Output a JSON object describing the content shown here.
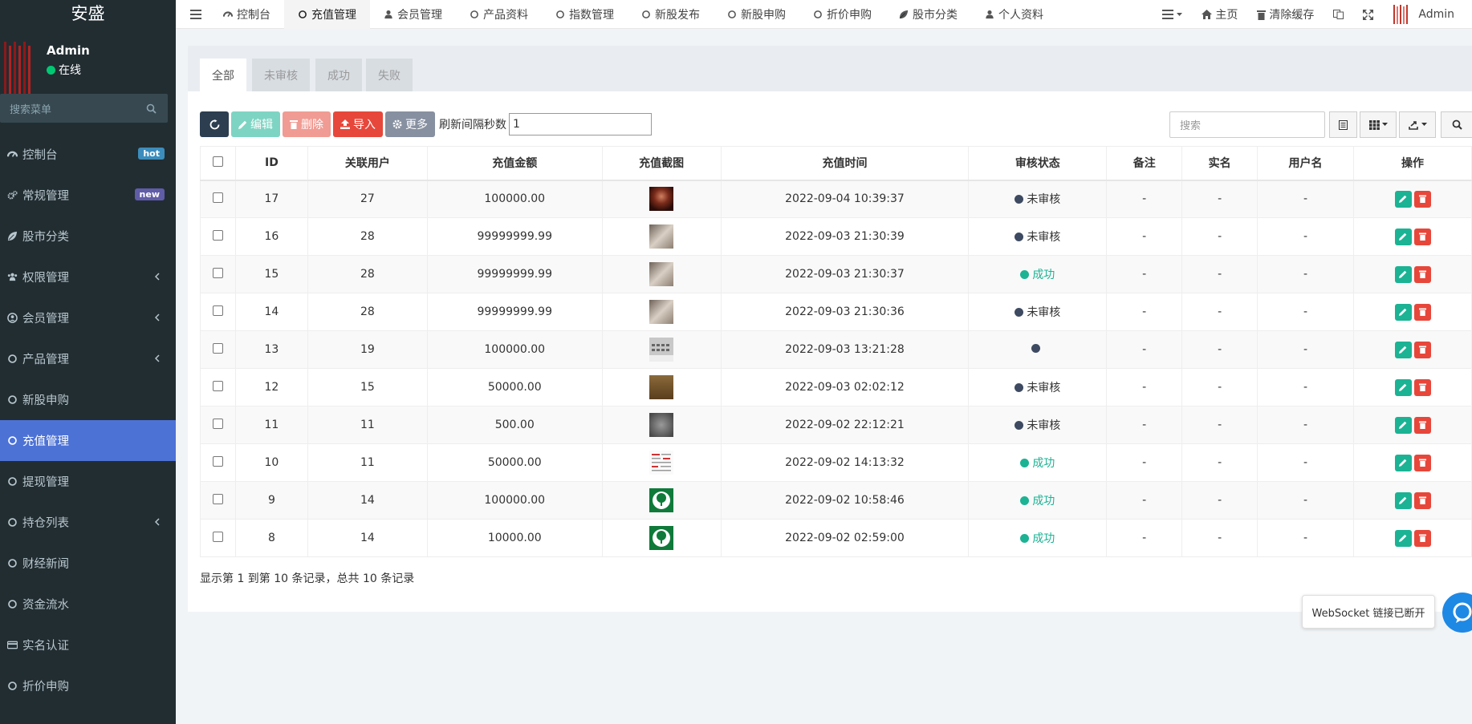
{
  "brand": "安盛",
  "user": {
    "name": "Admin",
    "status": "在线"
  },
  "sidebar": {
    "search_placeholder": "搜索菜单",
    "items": [
      {
        "label": "控制台",
        "icon": "dashboard-icon",
        "badge": "hot"
      },
      {
        "label": "常规管理",
        "icon": "cogs-icon",
        "badge": "new"
      },
      {
        "label": "股市分类",
        "icon": "leaf-icon"
      },
      {
        "label": "权限管理",
        "icon": "group-icon",
        "has_children": true
      },
      {
        "label": "会员管理",
        "icon": "user-circle-icon",
        "has_children": true
      },
      {
        "label": "产品管理",
        "icon": "circle-icon",
        "has_children": true
      },
      {
        "label": "新股申购",
        "icon": "circle-icon"
      },
      {
        "label": "充值管理",
        "icon": "circle-icon",
        "active": true
      },
      {
        "label": "提现管理",
        "icon": "circle-icon"
      },
      {
        "label": "持仓列表",
        "icon": "circle-icon",
        "has_children": true
      },
      {
        "label": "财经新闻",
        "icon": "circle-icon"
      },
      {
        "label": "资金流水",
        "icon": "circle-icon"
      },
      {
        "label": "实名认证",
        "icon": "credit-card-icon"
      },
      {
        "label": "折价申购",
        "icon": "circle-icon"
      }
    ]
  },
  "topnav": {
    "tabs": [
      {
        "label": "控制台",
        "icon": "dashboard-icon"
      },
      {
        "label": "充值管理",
        "icon": "circle-icon",
        "active": true
      },
      {
        "label": "会员管理",
        "icon": "user-icon"
      },
      {
        "label": "产品资料",
        "icon": "circle-icon"
      },
      {
        "label": "指数管理",
        "icon": "circle-icon"
      },
      {
        "label": "新股发布",
        "icon": "circle-icon"
      },
      {
        "label": "新股申购",
        "icon": "circle-icon"
      },
      {
        "label": "折价申购",
        "icon": "circle-icon"
      },
      {
        "label": "股市分类",
        "icon": "leaf-icon"
      },
      {
        "label": "个人资料",
        "icon": "user-icon"
      }
    ],
    "right": {
      "home": "主页",
      "clear_cache": "清除缓存",
      "admin": "Admin"
    }
  },
  "filter_tabs": [
    "全部",
    "未审核",
    "成功",
    "失败"
  ],
  "toolbar": {
    "edit": "编辑",
    "delete": "删除",
    "import": "导入",
    "more": "更多",
    "refresh_label": "刷新间隔秒数",
    "refresh_value": "1",
    "search_placeholder": "搜索"
  },
  "table": {
    "columns": [
      "ID",
      "关联用户",
      "充值金额",
      "充值截图",
      "充值时间",
      "审核状态",
      "备注",
      "实名",
      "用户名",
      "操作"
    ],
    "rows": [
      {
        "id": "17",
        "user": "27",
        "amount": "100000.00",
        "thumb": "dark-red",
        "time": "2022-09-04 10:39:37",
        "status": "未审核",
        "status_type": "pending",
        "remark": "-",
        "realname": "-",
        "username": "-"
      },
      {
        "id": "16",
        "user": "28",
        "amount": "99999999.99",
        "thumb": "beige",
        "time": "2022-09-03 21:30:39",
        "status": "未审核",
        "status_type": "pending",
        "remark": "-",
        "realname": "-",
        "username": "-"
      },
      {
        "id": "15",
        "user": "28",
        "amount": "99999999.99",
        "thumb": "beige",
        "time": "2022-09-03 21:30:37",
        "status": "成功",
        "status_type": "success",
        "remark": "-",
        "realname": "-",
        "username": "-"
      },
      {
        "id": "14",
        "user": "28",
        "amount": "99999999.99",
        "thumb": "beige",
        "time": "2022-09-03 21:30:36",
        "status": "未审核",
        "status_type": "pending",
        "remark": "-",
        "realname": "-",
        "username": "-"
      },
      {
        "id": "13",
        "user": "19",
        "amount": "100000.00",
        "thumb": "keyboard",
        "time": "2022-09-03 13:21:28",
        "status": "",
        "status_type": "pending",
        "remark": "-",
        "realname": "-",
        "username": "-"
      },
      {
        "id": "12",
        "user": "15",
        "amount": "50000.00",
        "thumb": "brown",
        "time": "2022-09-03 02:02:12",
        "status": "未审核",
        "status_type": "pending",
        "remark": "-",
        "realname": "-",
        "username": "-"
      },
      {
        "id": "11",
        "user": "11",
        "amount": "500.00",
        "thumb": "grey",
        "time": "2022-09-02 22:12:21",
        "status": "未审核",
        "status_type": "pending",
        "remark": "-",
        "realname": "-",
        "username": "-"
      },
      {
        "id": "10",
        "user": "11",
        "amount": "50000.00",
        "thumb": "document",
        "time": "2022-09-02 14:13:32",
        "status": "成功",
        "status_type": "success",
        "remark": "-",
        "realname": "-",
        "username": "-"
      },
      {
        "id": "9",
        "user": "14",
        "amount": "100000.00",
        "thumb": "tree-logo",
        "time": "2022-09-02 10:58:46",
        "status": "成功",
        "status_type": "success",
        "remark": "-",
        "realname": "-",
        "username": "-"
      },
      {
        "id": "8",
        "user": "14",
        "amount": "10000.00",
        "thumb": "tree-logo",
        "time": "2022-09-02 02:59:00",
        "status": "成功",
        "status_type": "success",
        "remark": "-",
        "realname": "-",
        "username": "-"
      }
    ]
  },
  "summary": "显示第 1 到第 10 条记录，总共 10 条记录",
  "websocket_toast": "WebSocket 链接已断开",
  "colors": {
    "sidebar_bg": "#222d32",
    "active_menu": "#4d72d6",
    "success": "#1bb394",
    "danger": "#e7473a"
  }
}
